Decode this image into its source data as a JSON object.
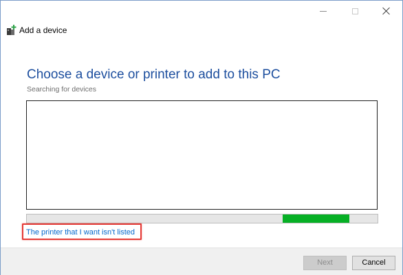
{
  "window": {
    "title": "Add a device",
    "icon": "add-device-icon"
  },
  "main": {
    "heading": "Choose a device or printer to add to this PC",
    "status": "Searching for devices",
    "progress_color": "#06b025",
    "progress": {
      "kind": "indeterminate-marquee",
      "shown_segment_start": 0.73,
      "shown_segment_end": 0.92
    },
    "link": "The printer that I want isn't listed",
    "link_color": "#0066cc",
    "highlight_color": "#e53935"
  },
  "footer": {
    "next_label": "Next",
    "cancel_label": "Cancel"
  },
  "colors": {
    "heading": "#1c4e9e",
    "footer_bg": "#f0f0f0",
    "window_border": "#7a9cc8"
  }
}
